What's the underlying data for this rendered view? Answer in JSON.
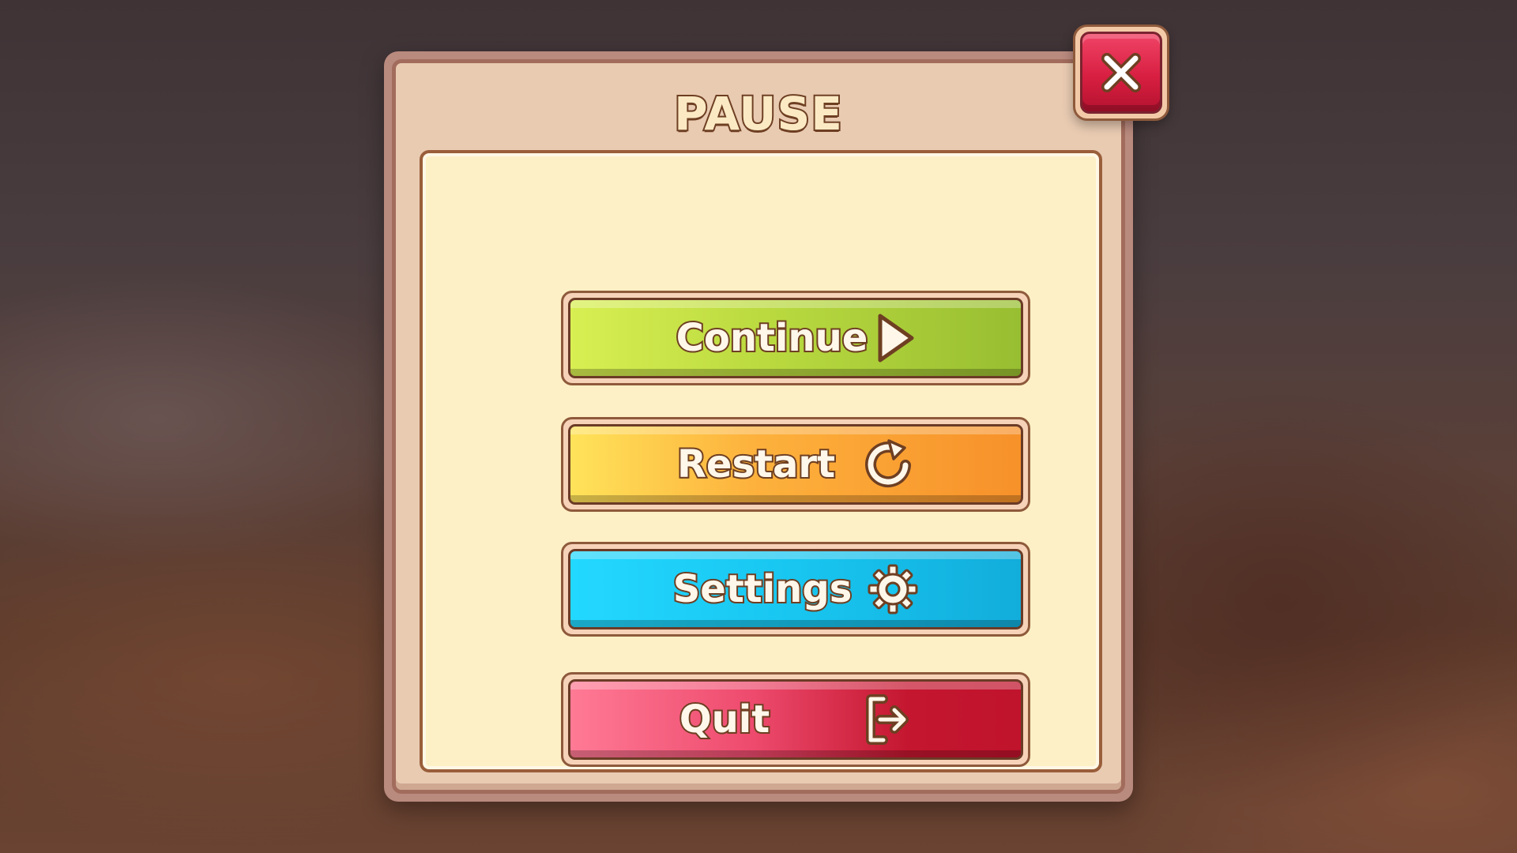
{
  "pause_menu": {
    "title": "PAUSE",
    "close_icon": "close-x-icon",
    "buttons": [
      {
        "label": "Continue",
        "icon": "play-icon",
        "color_start": "#d8ef52",
        "color_end": "#98be31"
      },
      {
        "label": "Restart",
        "icon": "restart-icon",
        "color_start": "#ffe35a",
        "color_end": "#f7912a"
      },
      {
        "label": "Settings",
        "icon": "gear-icon",
        "color_start": "#23d8ff",
        "color_end": "#12addb"
      },
      {
        "label": "Quit",
        "icon": "exit-icon",
        "color_start": "#ff7a95",
        "color_end": "#c0132c"
      }
    ]
  },
  "colors": {
    "panel_border": "#a26c5d",
    "panel_header": "#e9cbb2",
    "panel_body": "#fef0c6",
    "text_outline": "#6e3f22",
    "close_button": "#d81f42"
  }
}
